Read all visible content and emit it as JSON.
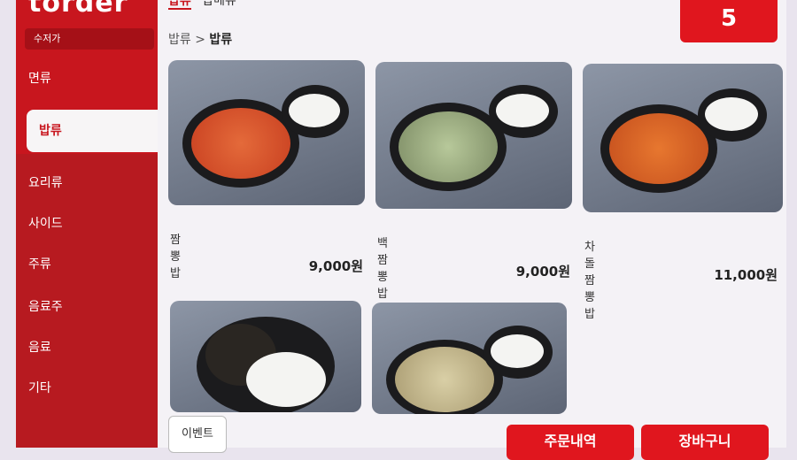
{
  "brand": "torder",
  "utensil_label": "수저가",
  "sidebar": {
    "items": [
      {
        "label": "면류"
      },
      {
        "label": "밥류"
      },
      {
        "label": "요리류"
      },
      {
        "label": "사이드"
      },
      {
        "label": "주류"
      },
      {
        "label": "음료주"
      },
      {
        "label": "음료"
      },
      {
        "label": "기타"
      }
    ]
  },
  "tabs": [
    {
      "label": "밥류"
    },
    {
      "label": "밥메뉴"
    }
  ],
  "breadcrumb": {
    "parent": "밥류",
    "sep": ">",
    "current": "밥류"
  },
  "cart_count": "5",
  "menu": [
    {
      "name": "짬뽕 밥",
      "price": "9,000원"
    },
    {
      "name": "백짬뽕 밥",
      "price": "9,000원"
    },
    {
      "name": "차돌짬뽕 밥",
      "price": "11,000원"
    },
    {
      "name": "",
      "price": ""
    },
    {
      "name": "",
      "price": ""
    }
  ],
  "buttons": {
    "event": "이벤트",
    "order_history": "주문내역",
    "cart": "장바구니"
  },
  "colors": {
    "accent": "#e0161e",
    "sidebar": "#c8161e"
  }
}
